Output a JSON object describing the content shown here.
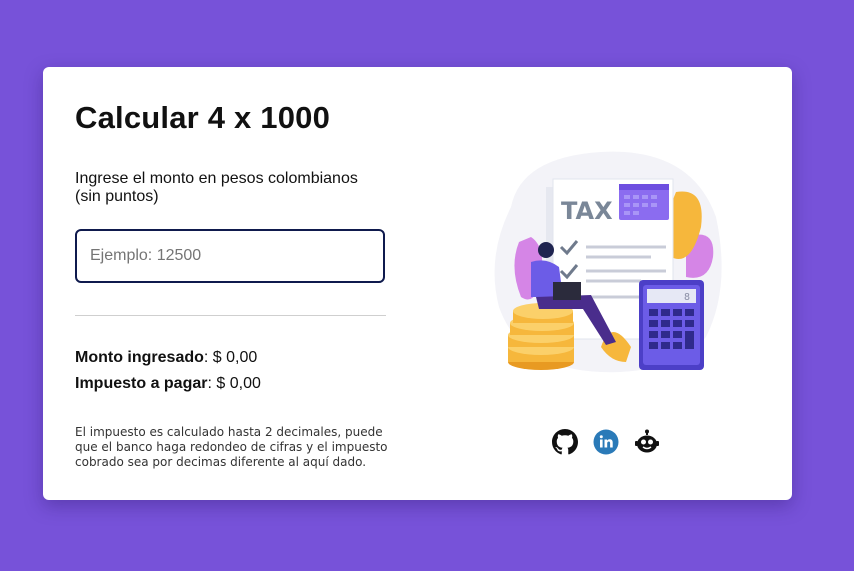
{
  "page": {
    "title": "Calcular 4 x 1000",
    "prompt": "Ingrese el monto en pesos colombianos (sin puntos)"
  },
  "input": {
    "placeholder": "Ejemplo: 12500",
    "value": ""
  },
  "results": {
    "amount_label": "Monto ingresado",
    "amount_value": ": $ 0,00",
    "tax_label": "Impuesto a pagar",
    "tax_value": ": $ 0,00"
  },
  "note": "El impuesto es calculado hasta 2 decimales, puede que el banco haga redondeo de cifras y el impuesto cobrado sea por decimas diferente al aquí dado.",
  "illustration": {
    "tax_text": "TAX",
    "calc_display": "8"
  },
  "social": [
    {
      "name": "github-icon"
    },
    {
      "name": "linkedin-icon"
    },
    {
      "name": "robot-icon"
    }
  ],
  "colors": {
    "background": "#7752d9",
    "card": "#ffffff",
    "input_border": "#0f1a4d",
    "linkedin": "#2a7ab8",
    "accent_purple": "#6c5ce7",
    "coin_gold": "#f6b73c"
  }
}
